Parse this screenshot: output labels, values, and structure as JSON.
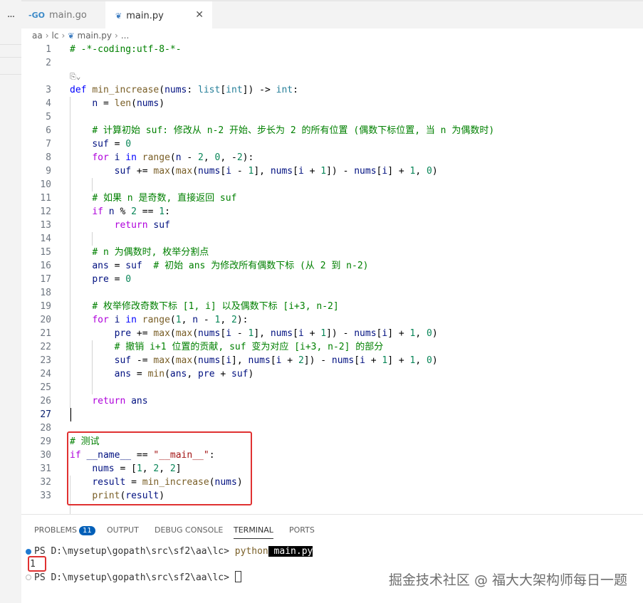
{
  "tabs": [
    {
      "label": "main.go",
      "icon": "go-icon"
    },
    {
      "label": "main.py",
      "icon": "python-icon",
      "close": "✕"
    }
  ],
  "overflow_menu": "...",
  "breadcrumb": {
    "parts": [
      "aa",
      "lc",
      "main.py",
      "..."
    ]
  },
  "codelens": "⎘⌄",
  "editor_lines": [
    {
      "n": "1",
      "tokens": [
        {
          "t": "# -*-coding:utf-8-*-",
          "c": "cm"
        }
      ]
    },
    {
      "n": "2",
      "tokens": []
    },
    {
      "n": "3",
      "tokens": [
        {
          "t": "def",
          "c": "kw"
        },
        {
          "t": " "
        },
        {
          "t": "min_increase",
          "c": "fn"
        },
        {
          "t": "("
        },
        {
          "t": "nums",
          "c": "var"
        },
        {
          "t": ": "
        },
        {
          "t": "list",
          "c": "ty"
        },
        {
          "t": "["
        },
        {
          "t": "int",
          "c": "ty"
        },
        {
          "t": "]) -> "
        },
        {
          "t": "int",
          "c": "ty"
        },
        {
          "t": ":"
        }
      ]
    },
    {
      "n": "4",
      "tokens": [
        {
          "t": "    "
        },
        {
          "t": "n",
          "c": "var"
        },
        {
          "t": " = "
        },
        {
          "t": "len",
          "c": "fn"
        },
        {
          "t": "("
        },
        {
          "t": "nums",
          "c": "var"
        },
        {
          "t": ")"
        }
      ]
    },
    {
      "n": "5",
      "tokens": []
    },
    {
      "n": "6",
      "tokens": [
        {
          "t": "    "
        },
        {
          "t": "# 计算初始 suf: 修改从 n-2 开始、步长为 2 的所有位置 (偶数下标位置, 当 n 为偶数时)",
          "c": "cm"
        }
      ]
    },
    {
      "n": "7",
      "tokens": [
        {
          "t": "    "
        },
        {
          "t": "suf",
          "c": "var"
        },
        {
          "t": " = "
        },
        {
          "t": "0",
          "c": "num"
        }
      ]
    },
    {
      "n": "8",
      "tokens": [
        {
          "t": "    "
        },
        {
          "t": "for",
          "c": "ctl"
        },
        {
          "t": " "
        },
        {
          "t": "i",
          "c": "var"
        },
        {
          "t": " "
        },
        {
          "t": "in",
          "c": "kw"
        },
        {
          "t": " "
        },
        {
          "t": "range",
          "c": "fn"
        },
        {
          "t": "("
        },
        {
          "t": "n",
          "c": "var"
        },
        {
          "t": " - "
        },
        {
          "t": "2",
          "c": "num"
        },
        {
          "t": ", "
        },
        {
          "t": "0",
          "c": "num"
        },
        {
          "t": ", -"
        },
        {
          "t": "2",
          "c": "num"
        },
        {
          "t": "):"
        }
      ]
    },
    {
      "n": "9",
      "tokens": [
        {
          "t": "        "
        },
        {
          "t": "suf",
          "c": "var"
        },
        {
          "t": " += "
        },
        {
          "t": "max",
          "c": "fn"
        },
        {
          "t": "("
        },
        {
          "t": "max",
          "c": "fn"
        },
        {
          "t": "("
        },
        {
          "t": "nums",
          "c": "var"
        },
        {
          "t": "["
        },
        {
          "t": "i",
          "c": "var"
        },
        {
          "t": " - "
        },
        {
          "t": "1",
          "c": "num"
        },
        {
          "t": "], "
        },
        {
          "t": "nums",
          "c": "var"
        },
        {
          "t": "["
        },
        {
          "t": "i",
          "c": "var"
        },
        {
          "t": " + "
        },
        {
          "t": "1",
          "c": "num"
        },
        {
          "t": "]) - "
        },
        {
          "t": "nums",
          "c": "var"
        },
        {
          "t": "["
        },
        {
          "t": "i",
          "c": "var"
        },
        {
          "t": "] + "
        },
        {
          "t": "1",
          "c": "num"
        },
        {
          "t": ", "
        },
        {
          "t": "0",
          "c": "num"
        },
        {
          "t": ")"
        }
      ]
    },
    {
      "n": "10",
      "tokens": []
    },
    {
      "n": "11",
      "tokens": [
        {
          "t": "    "
        },
        {
          "t": "# 如果 n 是奇数, 直接返回 suf",
          "c": "cm"
        }
      ]
    },
    {
      "n": "12",
      "tokens": [
        {
          "t": "    "
        },
        {
          "t": "if",
          "c": "ctl"
        },
        {
          "t": " "
        },
        {
          "t": "n",
          "c": "var"
        },
        {
          "t": " % "
        },
        {
          "t": "2",
          "c": "num"
        },
        {
          "t": " == "
        },
        {
          "t": "1",
          "c": "num"
        },
        {
          "t": ":"
        }
      ]
    },
    {
      "n": "13",
      "tokens": [
        {
          "t": "        "
        },
        {
          "t": "return",
          "c": "ctl"
        },
        {
          "t": " "
        },
        {
          "t": "suf",
          "c": "var"
        }
      ]
    },
    {
      "n": "14",
      "tokens": []
    },
    {
      "n": "15",
      "tokens": [
        {
          "t": "    "
        },
        {
          "t": "# n 为偶数时, 枚举分割点",
          "c": "cm"
        }
      ]
    },
    {
      "n": "16",
      "tokens": [
        {
          "t": "    "
        },
        {
          "t": "ans",
          "c": "var"
        },
        {
          "t": " = "
        },
        {
          "t": "suf",
          "c": "var"
        },
        {
          "t": "  "
        },
        {
          "t": "# 初始 ans 为修改所有偶数下标 (从 2 到 n-2)",
          "c": "cm"
        }
      ]
    },
    {
      "n": "17",
      "tokens": [
        {
          "t": "    "
        },
        {
          "t": "pre",
          "c": "var"
        },
        {
          "t": " = "
        },
        {
          "t": "0",
          "c": "num"
        }
      ]
    },
    {
      "n": "18",
      "tokens": []
    },
    {
      "n": "19",
      "tokens": [
        {
          "t": "    "
        },
        {
          "t": "# 枚举修改奇数下标 [1, i] 以及偶数下标 [i+3, n-2]",
          "c": "cm"
        }
      ]
    },
    {
      "n": "20",
      "tokens": [
        {
          "t": "    "
        },
        {
          "t": "for",
          "c": "ctl"
        },
        {
          "t": " "
        },
        {
          "t": "i",
          "c": "var"
        },
        {
          "t": " "
        },
        {
          "t": "in",
          "c": "kw"
        },
        {
          "t": " "
        },
        {
          "t": "range",
          "c": "fn"
        },
        {
          "t": "("
        },
        {
          "t": "1",
          "c": "num"
        },
        {
          "t": ", "
        },
        {
          "t": "n",
          "c": "var"
        },
        {
          "t": " - "
        },
        {
          "t": "1",
          "c": "num"
        },
        {
          "t": ", "
        },
        {
          "t": "2",
          "c": "num"
        },
        {
          "t": "):"
        }
      ]
    },
    {
      "n": "21",
      "tokens": [
        {
          "t": "        "
        },
        {
          "t": "pre",
          "c": "var"
        },
        {
          "t": " += "
        },
        {
          "t": "max",
          "c": "fn"
        },
        {
          "t": "("
        },
        {
          "t": "max",
          "c": "fn"
        },
        {
          "t": "("
        },
        {
          "t": "nums",
          "c": "var"
        },
        {
          "t": "["
        },
        {
          "t": "i",
          "c": "var"
        },
        {
          "t": " - "
        },
        {
          "t": "1",
          "c": "num"
        },
        {
          "t": "], "
        },
        {
          "t": "nums",
          "c": "var"
        },
        {
          "t": "["
        },
        {
          "t": "i",
          "c": "var"
        },
        {
          "t": " + "
        },
        {
          "t": "1",
          "c": "num"
        },
        {
          "t": "]) - "
        },
        {
          "t": "nums",
          "c": "var"
        },
        {
          "t": "["
        },
        {
          "t": "i",
          "c": "var"
        },
        {
          "t": "] + "
        },
        {
          "t": "1",
          "c": "num"
        },
        {
          "t": ", "
        },
        {
          "t": "0",
          "c": "num"
        },
        {
          "t": ")"
        }
      ]
    },
    {
      "n": "22",
      "tokens": [
        {
          "t": "        "
        },
        {
          "t": "# 撤销 i+1 位置的贡献, suf 变为对应 [i+3, n-2] 的部分",
          "c": "cm"
        }
      ]
    },
    {
      "n": "23",
      "tokens": [
        {
          "t": "        "
        },
        {
          "t": "suf",
          "c": "var"
        },
        {
          "t": " -= "
        },
        {
          "t": "max",
          "c": "fn"
        },
        {
          "t": "("
        },
        {
          "t": "max",
          "c": "fn"
        },
        {
          "t": "("
        },
        {
          "t": "nums",
          "c": "var"
        },
        {
          "t": "["
        },
        {
          "t": "i",
          "c": "var"
        },
        {
          "t": "], "
        },
        {
          "t": "nums",
          "c": "var"
        },
        {
          "t": "["
        },
        {
          "t": "i",
          "c": "var"
        },
        {
          "t": " + "
        },
        {
          "t": "2",
          "c": "num"
        },
        {
          "t": "]) - "
        },
        {
          "t": "nums",
          "c": "var"
        },
        {
          "t": "["
        },
        {
          "t": "i",
          "c": "var"
        },
        {
          "t": " + "
        },
        {
          "t": "1",
          "c": "num"
        },
        {
          "t": "] + "
        },
        {
          "t": "1",
          "c": "num"
        },
        {
          "t": ", "
        },
        {
          "t": "0",
          "c": "num"
        },
        {
          "t": ")"
        }
      ]
    },
    {
      "n": "24",
      "tokens": [
        {
          "t": "        "
        },
        {
          "t": "ans",
          "c": "var"
        },
        {
          "t": " = "
        },
        {
          "t": "min",
          "c": "fn"
        },
        {
          "t": "("
        },
        {
          "t": "ans",
          "c": "var"
        },
        {
          "t": ", "
        },
        {
          "t": "pre",
          "c": "var"
        },
        {
          "t": " + "
        },
        {
          "t": "suf",
          "c": "var"
        },
        {
          "t": ")"
        }
      ]
    },
    {
      "n": "25",
      "tokens": []
    },
    {
      "n": "26",
      "tokens": [
        {
          "t": "    "
        },
        {
          "t": "return",
          "c": "ctl"
        },
        {
          "t": " "
        },
        {
          "t": "ans",
          "c": "var"
        }
      ]
    },
    {
      "n": "27",
      "tokens": []
    },
    {
      "n": "28",
      "tokens": []
    },
    {
      "n": "29",
      "tokens": [
        {
          "t": "# 测试",
          "c": "cm"
        }
      ]
    },
    {
      "n": "30",
      "tokens": [
        {
          "t": "if",
          "c": "ctl"
        },
        {
          "t": " "
        },
        {
          "t": "__name__",
          "c": "var"
        },
        {
          "t": " == "
        },
        {
          "t": "\"__main__\"",
          "c": "str"
        },
        {
          "t": ":"
        }
      ]
    },
    {
      "n": "31",
      "tokens": [
        {
          "t": "    "
        },
        {
          "t": "nums",
          "c": "var"
        },
        {
          "t": " = ["
        },
        {
          "t": "1",
          "c": "num"
        },
        {
          "t": ", "
        },
        {
          "t": "2",
          "c": "num"
        },
        {
          "t": ", "
        },
        {
          "t": "2",
          "c": "num"
        },
        {
          "t": "]"
        }
      ]
    },
    {
      "n": "32",
      "tokens": [
        {
          "t": "    "
        },
        {
          "t": "result",
          "c": "var"
        },
        {
          "t": " = "
        },
        {
          "t": "min_increase",
          "c": "fn"
        },
        {
          "t": "("
        },
        {
          "t": "nums",
          "c": "var"
        },
        {
          "t": ")"
        }
      ]
    },
    {
      "n": "33",
      "tokens": [
        {
          "t": "    "
        },
        {
          "t": "print",
          "c": "fn"
        },
        {
          "t": "("
        },
        {
          "t": "result",
          "c": "var"
        },
        {
          "t": ")"
        }
      ]
    }
  ],
  "panel": {
    "tabs": [
      "PROBLEMS",
      "OUTPUT",
      "DEBUG CONSOLE",
      "TERMINAL",
      "PORTS"
    ],
    "problems_count": "11",
    "active_tab": "TERMINAL"
  },
  "terminal": {
    "prompt1": "PS D:\\mysetup\\gopath\\src\\sf2\\aa\\lc> ",
    "cmd": "python",
    "arg": " main.py",
    "output": "1",
    "prompt2": "PS D:\\mysetup\\gopath\\src\\sf2\\aa\\lc> "
  },
  "watermark": "掘金技术社区 @ 福大大架构师每日一题",
  "colors": {
    "accent": "#005fb8",
    "highlight_box": "#e03131",
    "comment": "#008000",
    "keyword": "#0000ff"
  }
}
